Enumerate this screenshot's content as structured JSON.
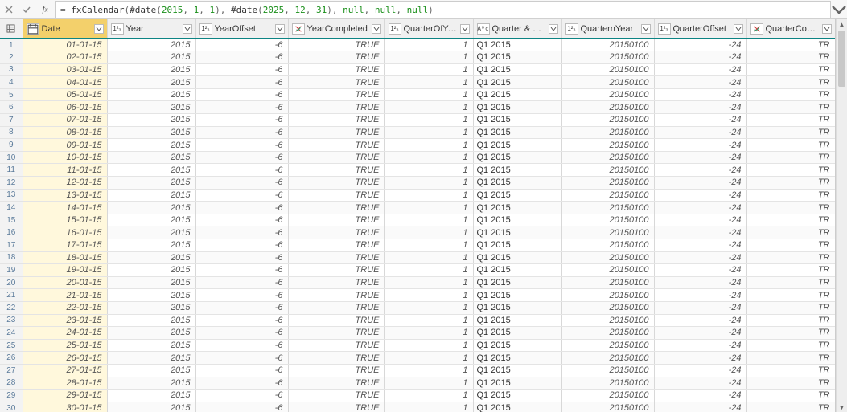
{
  "formula_bar": {
    "placeholder": "",
    "raw": "= fxCalendar(#date(2015, 1, 1), #date(2025, 12, 31), null, null, null)",
    "tokens": [
      {
        "t": "= ",
        "c": "op"
      },
      {
        "t": "fxCalendar",
        "c": "fn"
      },
      {
        "t": "(",
        "c": "op"
      },
      {
        "t": "#date",
        "c": "fn"
      },
      {
        "t": "(",
        "c": "op"
      },
      {
        "t": "2015",
        "c": "num"
      },
      {
        "t": ", ",
        "c": "op"
      },
      {
        "t": "1",
        "c": "num"
      },
      {
        "t": ", ",
        "c": "op"
      },
      {
        "t": "1",
        "c": "num"
      },
      {
        "t": "), ",
        "c": "op"
      },
      {
        "t": "#date",
        "c": "fn"
      },
      {
        "t": "(",
        "c": "op"
      },
      {
        "t": "2025",
        "c": "num"
      },
      {
        "t": ", ",
        "c": "op"
      },
      {
        "t": "12",
        "c": "num"
      },
      {
        "t": ", ",
        "c": "op"
      },
      {
        "t": "31",
        "c": "num"
      },
      {
        "t": "), ",
        "c": "op"
      },
      {
        "t": "null",
        "c": "kw"
      },
      {
        "t": ", ",
        "c": "op"
      },
      {
        "t": "null",
        "c": "kw"
      },
      {
        "t": ", ",
        "c": "op"
      },
      {
        "t": "null",
        "c": "kw"
      },
      {
        "t": ")",
        "c": "op"
      }
    ]
  },
  "columns": [
    {
      "key": "Date",
      "label": "Date",
      "type": "date",
      "cls": "c-date",
      "align": "r",
      "selected": true
    },
    {
      "key": "Year",
      "label": "Year",
      "type": "int",
      "cls": "c-year",
      "align": "r"
    },
    {
      "key": "YearOffset",
      "label": "YearOffset",
      "type": "int",
      "cls": "c-yoff",
      "align": "r"
    },
    {
      "key": "YearCompleted",
      "label": "YearCompleted",
      "type": "bool",
      "cls": "c-ycomp",
      "align": "r"
    },
    {
      "key": "QuarterOfYear",
      "label": "QuarterOfYear",
      "type": "int",
      "cls": "c-qoy",
      "align": "r"
    },
    {
      "key": "QuarterYear",
      "label": "Quarter & Year",
      "type": "text",
      "cls": "c-qy",
      "align": "l"
    },
    {
      "key": "QuarternYear",
      "label": "QuarternYear",
      "type": "int",
      "cls": "c-qny",
      "align": "r"
    },
    {
      "key": "QuarterOffset",
      "label": "QuarterOffset",
      "type": "int",
      "cls": "c-qoff",
      "align": "r"
    },
    {
      "key": "QuarterCompleted",
      "label": "QuarterCompleted",
      "type": "bool",
      "cls": "c-qcomp",
      "align": "r"
    }
  ],
  "type_icon_label": {
    "date": "",
    "int": "1²₃",
    "bool": "",
    "text": "Aᴮc"
  },
  "rows": [
    {
      "n": 1,
      "Date": "01-01-15",
      "Year": "2015",
      "YearOffset": "-6",
      "YearCompleted": "TRUE",
      "QuarterOfYear": "1",
      "QuarterYear": "Q1 2015",
      "QuarternYear": "20150100",
      "QuarterOffset": "-24",
      "QuarterCompleted": "TR"
    },
    {
      "n": 2,
      "Date": "02-01-15",
      "Year": "2015",
      "YearOffset": "-6",
      "YearCompleted": "TRUE",
      "QuarterOfYear": "1",
      "QuarterYear": "Q1 2015",
      "QuarternYear": "20150100",
      "QuarterOffset": "-24",
      "QuarterCompleted": "TR"
    },
    {
      "n": 3,
      "Date": "03-01-15",
      "Year": "2015",
      "YearOffset": "-6",
      "YearCompleted": "TRUE",
      "QuarterOfYear": "1",
      "QuarterYear": "Q1 2015",
      "QuarternYear": "20150100",
      "QuarterOffset": "-24",
      "QuarterCompleted": "TR"
    },
    {
      "n": 4,
      "Date": "04-01-15",
      "Year": "2015",
      "YearOffset": "-6",
      "YearCompleted": "TRUE",
      "QuarterOfYear": "1",
      "QuarterYear": "Q1 2015",
      "QuarternYear": "20150100",
      "QuarterOffset": "-24",
      "QuarterCompleted": "TR"
    },
    {
      "n": 5,
      "Date": "05-01-15",
      "Year": "2015",
      "YearOffset": "-6",
      "YearCompleted": "TRUE",
      "QuarterOfYear": "1",
      "QuarterYear": "Q1 2015",
      "QuarternYear": "20150100",
      "QuarterOffset": "-24",
      "QuarterCompleted": "TR"
    },
    {
      "n": 6,
      "Date": "06-01-15",
      "Year": "2015",
      "YearOffset": "-6",
      "YearCompleted": "TRUE",
      "QuarterOfYear": "1",
      "QuarterYear": "Q1 2015",
      "QuarternYear": "20150100",
      "QuarterOffset": "-24",
      "QuarterCompleted": "TR"
    },
    {
      "n": 7,
      "Date": "07-01-15",
      "Year": "2015",
      "YearOffset": "-6",
      "YearCompleted": "TRUE",
      "QuarterOfYear": "1",
      "QuarterYear": "Q1 2015",
      "QuarternYear": "20150100",
      "QuarterOffset": "-24",
      "QuarterCompleted": "TR"
    },
    {
      "n": 8,
      "Date": "08-01-15",
      "Year": "2015",
      "YearOffset": "-6",
      "YearCompleted": "TRUE",
      "QuarterOfYear": "1",
      "QuarterYear": "Q1 2015",
      "QuarternYear": "20150100",
      "QuarterOffset": "-24",
      "QuarterCompleted": "TR"
    },
    {
      "n": 9,
      "Date": "09-01-15",
      "Year": "2015",
      "YearOffset": "-6",
      "YearCompleted": "TRUE",
      "QuarterOfYear": "1",
      "QuarterYear": "Q1 2015",
      "QuarternYear": "20150100",
      "QuarterOffset": "-24",
      "QuarterCompleted": "TR"
    },
    {
      "n": 10,
      "Date": "10-01-15",
      "Year": "2015",
      "YearOffset": "-6",
      "YearCompleted": "TRUE",
      "QuarterOfYear": "1",
      "QuarterYear": "Q1 2015",
      "QuarternYear": "20150100",
      "QuarterOffset": "-24",
      "QuarterCompleted": "TR"
    },
    {
      "n": 11,
      "Date": "11-01-15",
      "Year": "2015",
      "YearOffset": "-6",
      "YearCompleted": "TRUE",
      "QuarterOfYear": "1",
      "QuarterYear": "Q1 2015",
      "QuarternYear": "20150100",
      "QuarterOffset": "-24",
      "QuarterCompleted": "TR"
    },
    {
      "n": 12,
      "Date": "12-01-15",
      "Year": "2015",
      "YearOffset": "-6",
      "YearCompleted": "TRUE",
      "QuarterOfYear": "1",
      "QuarterYear": "Q1 2015",
      "QuarternYear": "20150100",
      "QuarterOffset": "-24",
      "QuarterCompleted": "TR"
    },
    {
      "n": 13,
      "Date": "13-01-15",
      "Year": "2015",
      "YearOffset": "-6",
      "YearCompleted": "TRUE",
      "QuarterOfYear": "1",
      "QuarterYear": "Q1 2015",
      "QuarternYear": "20150100",
      "QuarterOffset": "-24",
      "QuarterCompleted": "TR"
    },
    {
      "n": 14,
      "Date": "14-01-15",
      "Year": "2015",
      "YearOffset": "-6",
      "YearCompleted": "TRUE",
      "QuarterOfYear": "1",
      "QuarterYear": "Q1 2015",
      "QuarternYear": "20150100",
      "QuarterOffset": "-24",
      "QuarterCompleted": "TR"
    },
    {
      "n": 15,
      "Date": "15-01-15",
      "Year": "2015",
      "YearOffset": "-6",
      "YearCompleted": "TRUE",
      "QuarterOfYear": "1",
      "QuarterYear": "Q1 2015",
      "QuarternYear": "20150100",
      "QuarterOffset": "-24",
      "QuarterCompleted": "TR"
    },
    {
      "n": 16,
      "Date": "16-01-15",
      "Year": "2015",
      "YearOffset": "-6",
      "YearCompleted": "TRUE",
      "QuarterOfYear": "1",
      "QuarterYear": "Q1 2015",
      "QuarternYear": "20150100",
      "QuarterOffset": "-24",
      "QuarterCompleted": "TR"
    },
    {
      "n": 17,
      "Date": "17-01-15",
      "Year": "2015",
      "YearOffset": "-6",
      "YearCompleted": "TRUE",
      "QuarterOfYear": "1",
      "QuarterYear": "Q1 2015",
      "QuarternYear": "20150100",
      "QuarterOffset": "-24",
      "QuarterCompleted": "TR"
    },
    {
      "n": 18,
      "Date": "18-01-15",
      "Year": "2015",
      "YearOffset": "-6",
      "YearCompleted": "TRUE",
      "QuarterOfYear": "1",
      "QuarterYear": "Q1 2015",
      "QuarternYear": "20150100",
      "QuarterOffset": "-24",
      "QuarterCompleted": "TR"
    },
    {
      "n": 19,
      "Date": "19-01-15",
      "Year": "2015",
      "YearOffset": "-6",
      "YearCompleted": "TRUE",
      "QuarterOfYear": "1",
      "QuarterYear": "Q1 2015",
      "QuarternYear": "20150100",
      "QuarterOffset": "-24",
      "QuarterCompleted": "TR"
    },
    {
      "n": 20,
      "Date": "20-01-15",
      "Year": "2015",
      "YearOffset": "-6",
      "YearCompleted": "TRUE",
      "QuarterOfYear": "1",
      "QuarterYear": "Q1 2015",
      "QuarternYear": "20150100",
      "QuarterOffset": "-24",
      "QuarterCompleted": "TR"
    },
    {
      "n": 21,
      "Date": "21-01-15",
      "Year": "2015",
      "YearOffset": "-6",
      "YearCompleted": "TRUE",
      "QuarterOfYear": "1",
      "QuarterYear": "Q1 2015",
      "QuarternYear": "20150100",
      "QuarterOffset": "-24",
      "QuarterCompleted": "TR"
    },
    {
      "n": 22,
      "Date": "22-01-15",
      "Year": "2015",
      "YearOffset": "-6",
      "YearCompleted": "TRUE",
      "QuarterOfYear": "1",
      "QuarterYear": "Q1 2015",
      "QuarternYear": "20150100",
      "QuarterOffset": "-24",
      "QuarterCompleted": "TR"
    },
    {
      "n": 23,
      "Date": "23-01-15",
      "Year": "2015",
      "YearOffset": "-6",
      "YearCompleted": "TRUE",
      "QuarterOfYear": "1",
      "QuarterYear": "Q1 2015",
      "QuarternYear": "20150100",
      "QuarterOffset": "-24",
      "QuarterCompleted": "TR"
    },
    {
      "n": 24,
      "Date": "24-01-15",
      "Year": "2015",
      "YearOffset": "-6",
      "YearCompleted": "TRUE",
      "QuarterOfYear": "1",
      "QuarterYear": "Q1 2015",
      "QuarternYear": "20150100",
      "QuarterOffset": "-24",
      "QuarterCompleted": "TR"
    },
    {
      "n": 25,
      "Date": "25-01-15",
      "Year": "2015",
      "YearOffset": "-6",
      "YearCompleted": "TRUE",
      "QuarterOfYear": "1",
      "QuarterYear": "Q1 2015",
      "QuarternYear": "20150100",
      "QuarterOffset": "-24",
      "QuarterCompleted": "TR"
    },
    {
      "n": 26,
      "Date": "26-01-15",
      "Year": "2015",
      "YearOffset": "-6",
      "YearCompleted": "TRUE",
      "QuarterOfYear": "1",
      "QuarterYear": "Q1 2015",
      "QuarternYear": "20150100",
      "QuarterOffset": "-24",
      "QuarterCompleted": "TR"
    },
    {
      "n": 27,
      "Date": "27-01-15",
      "Year": "2015",
      "YearOffset": "-6",
      "YearCompleted": "TRUE",
      "QuarterOfYear": "1",
      "QuarterYear": "Q1 2015",
      "QuarternYear": "20150100",
      "QuarterOffset": "-24",
      "QuarterCompleted": "TR"
    },
    {
      "n": 28,
      "Date": "28-01-15",
      "Year": "2015",
      "YearOffset": "-6",
      "YearCompleted": "TRUE",
      "QuarterOfYear": "1",
      "QuarterYear": "Q1 2015",
      "QuarternYear": "20150100",
      "QuarterOffset": "-24",
      "QuarterCompleted": "TR"
    },
    {
      "n": 29,
      "Date": "29-01-15",
      "Year": "2015",
      "YearOffset": "-6",
      "YearCompleted": "TRUE",
      "QuarterOfYear": "1",
      "QuarterYear": "Q1 2015",
      "QuarternYear": "20150100",
      "QuarterOffset": "-24",
      "QuarterCompleted": "TR"
    },
    {
      "n": 30,
      "Date": "30-01-15",
      "Year": "2015",
      "YearOffset": "-6",
      "YearCompleted": "TRUE",
      "QuarterOfYear": "1",
      "QuarterYear": "Q1 2015",
      "QuarternYear": "20150100",
      "QuarterOffset": "-24",
      "QuarterCompleted": "TR"
    }
  ]
}
